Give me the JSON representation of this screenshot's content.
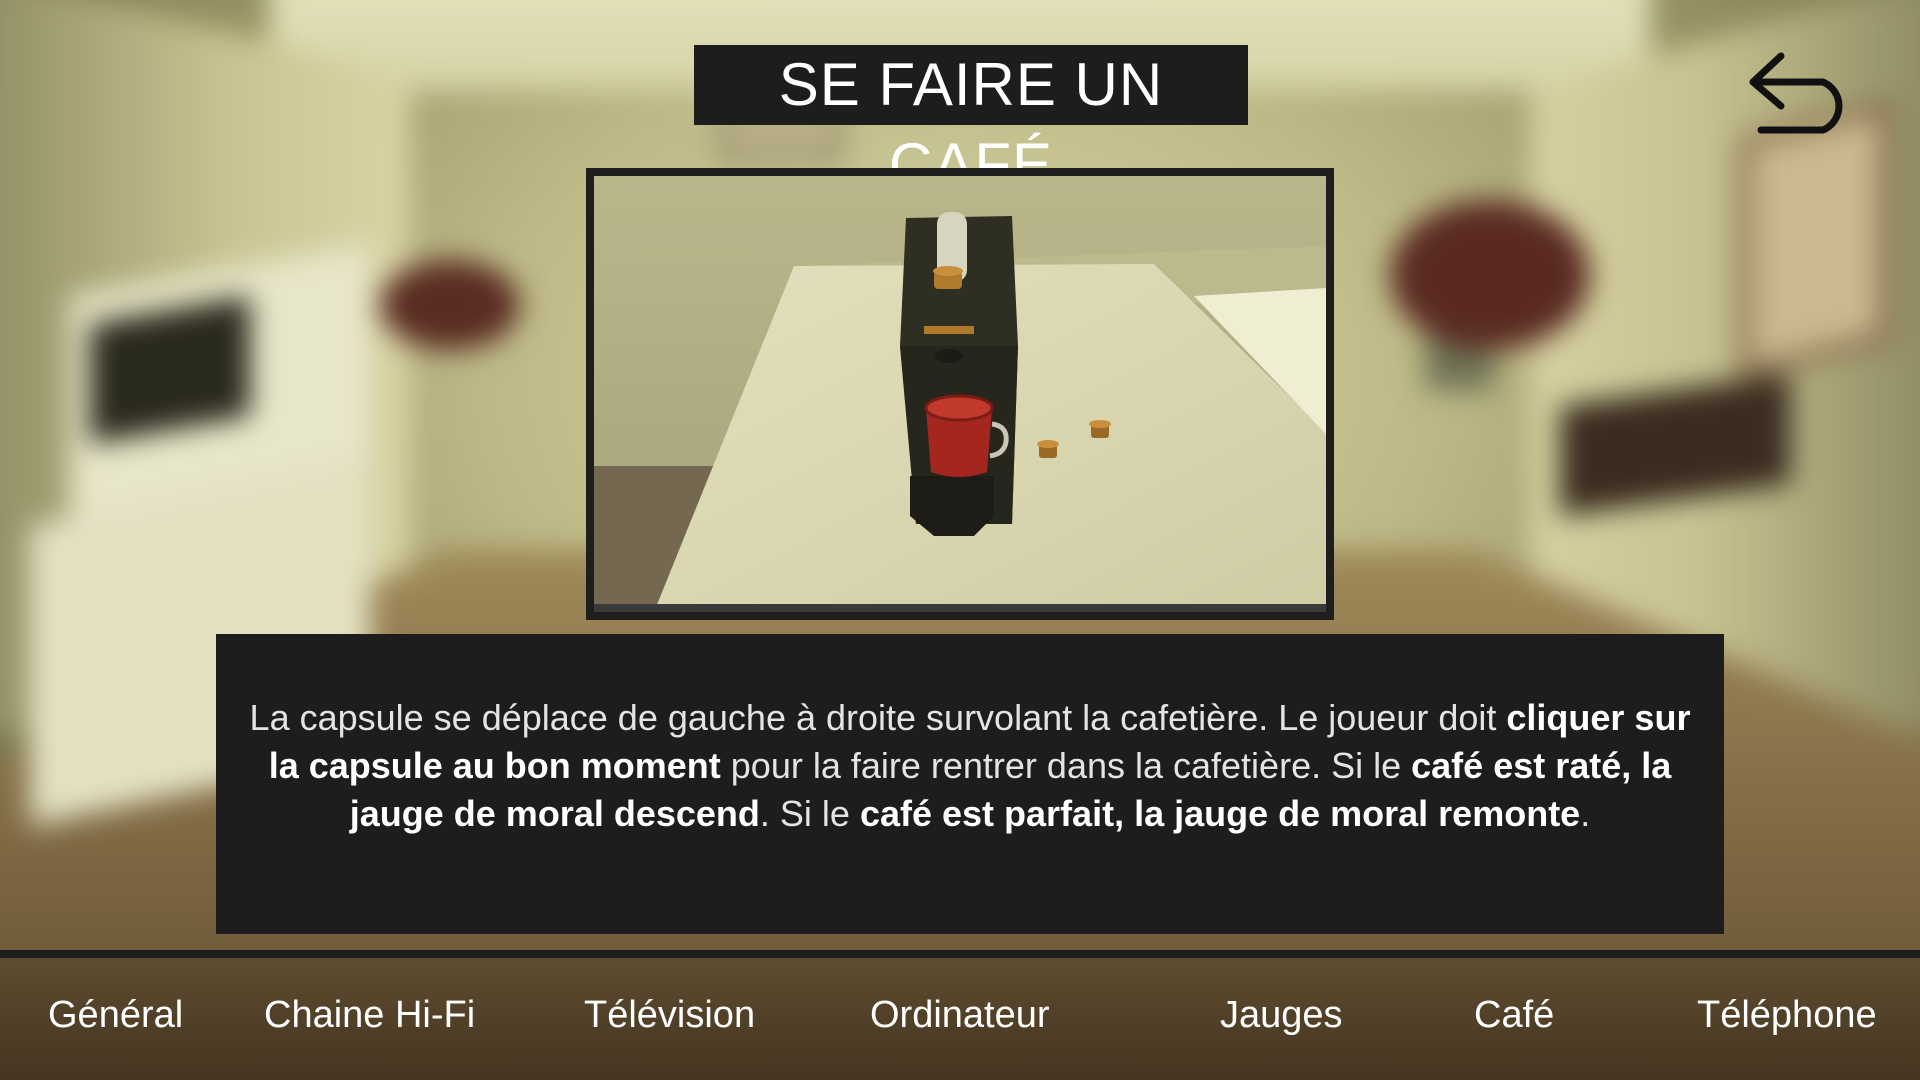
{
  "title": "SE FAIRE UN CAFÉ",
  "description": {
    "p1": "La capsule se déplace de gauche à droite survolant la cafetière. Le joueur doit ",
    "b1": "cliquer sur la capsule au bon moment",
    "p2": " pour la faire rentrer dans la cafetière. Si le ",
    "b2": "café est raté, la jauge de moral descend",
    "p3": ". Si le ",
    "b3": "café est parfait, la jauge de moral remonte",
    "p4": "."
  },
  "nav": {
    "items": [
      {
        "label": "Général"
      },
      {
        "label": "Chaine Hi-Fi"
      },
      {
        "label": "Télévision"
      },
      {
        "label": "Ordinateur"
      },
      {
        "label": "Jauges"
      },
      {
        "label": "Café"
      },
      {
        "label": "Téléphone"
      }
    ]
  },
  "icons": {
    "back": "back-arrow-icon"
  },
  "colors": {
    "panel": "#1d1d1d",
    "text": "#ffffff",
    "cup": "#a3261f",
    "capsule": "#b07a2c"
  }
}
